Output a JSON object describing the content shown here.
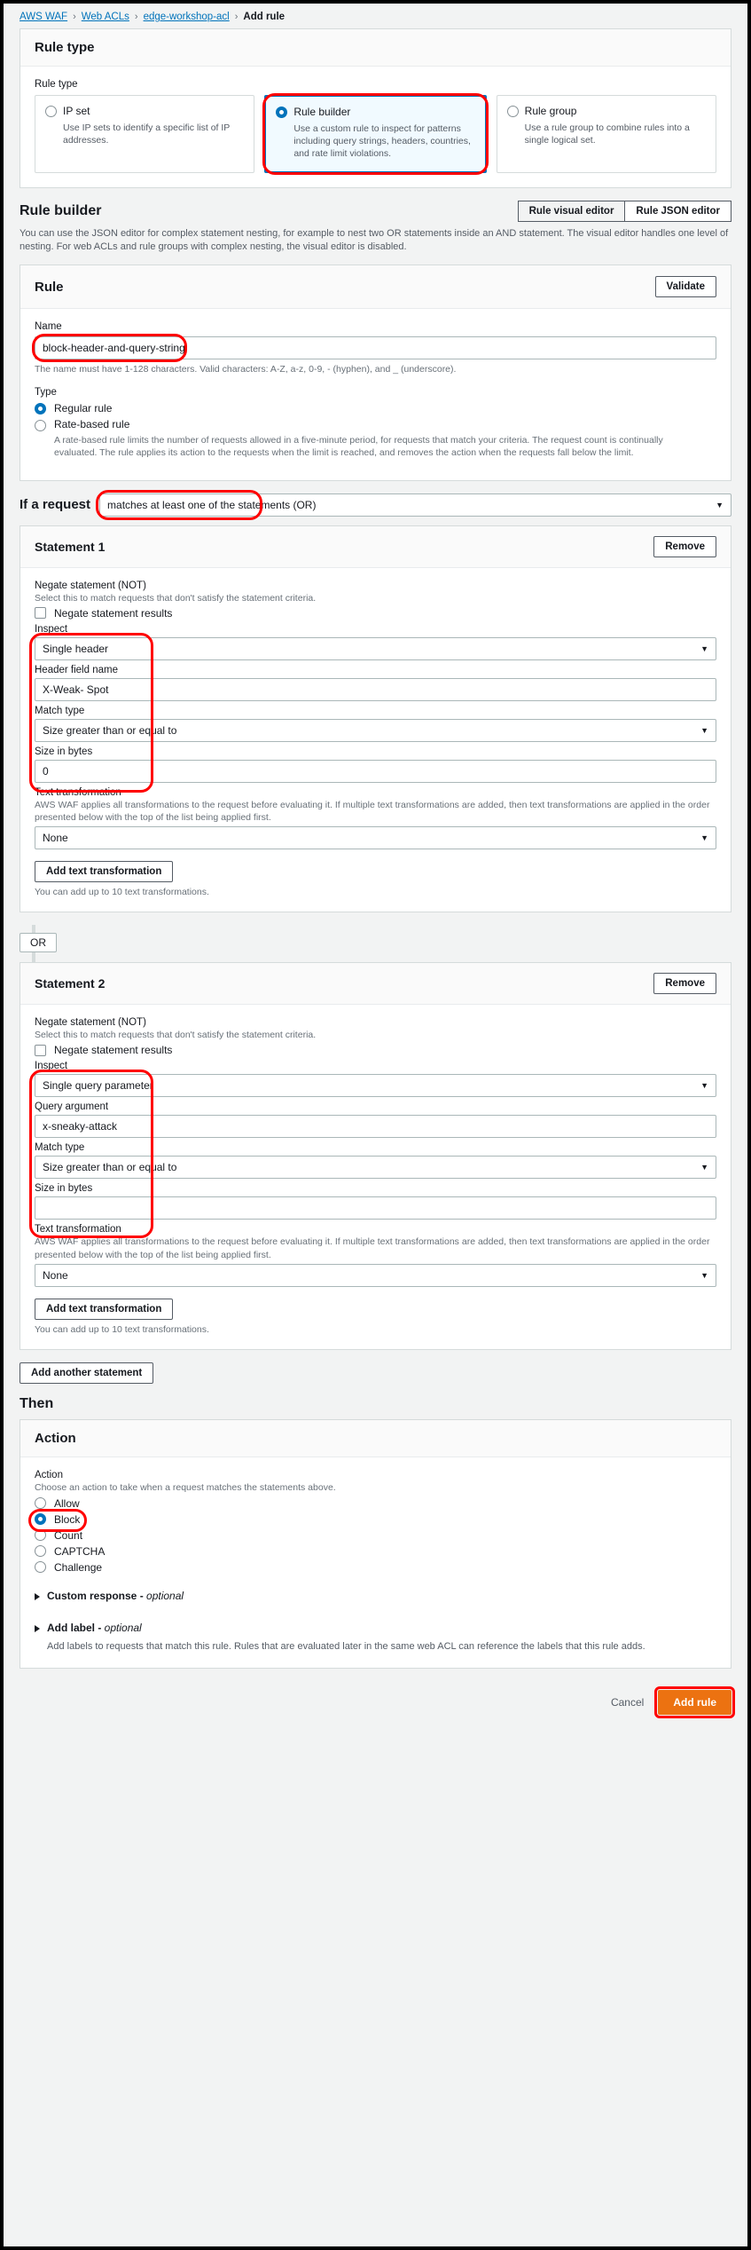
{
  "breadcrumb": {
    "items": [
      {
        "label": "AWS WAF",
        "link": true
      },
      {
        "label": "Web ACLs",
        "link": true
      },
      {
        "label": "edge-workshop-acl",
        "link": true
      },
      {
        "label": "Add rule",
        "link": false
      }
    ],
    "separator": "›"
  },
  "rule_type_section": {
    "title": "Rule type",
    "field_label": "Rule type",
    "cards": [
      {
        "title": "IP set",
        "description": "Use IP sets to identify a specific list of IP addresses.",
        "selected": false
      },
      {
        "title": "Rule builder",
        "description": "Use a custom rule to inspect for patterns including query strings, headers, countries, and rate limit violations.",
        "selected": true
      },
      {
        "title": "Rule group",
        "description": "Use a rule group to combine rules into a single logical set.",
        "selected": false
      }
    ]
  },
  "rule_builder": {
    "title": "Rule builder",
    "toggle": {
      "visual_editor": "Rule visual editor",
      "json_editor": "Rule JSON editor",
      "active": "Rule visual editor"
    },
    "description": "You can use the JSON editor for complex statement nesting, for example to nest two OR statements inside an AND statement. The visual editor handles one level of nesting. For web ACLs and rule groups with complex nesting, the visual editor is disabled."
  },
  "rule": {
    "title": "Rule",
    "validate_button": "Validate",
    "name_label": "Name",
    "name_value": "block-header-and-query-string",
    "name_constraint": "The name must have 1-128 characters. Valid characters: A-Z, a-z, 0-9, - (hyphen), and _ (underscore).",
    "type_label": "Type",
    "types": [
      {
        "label": "Regular rule",
        "selected": true,
        "description": ""
      },
      {
        "label": "Rate-based rule",
        "selected": false,
        "description": "A rate-based rule limits the number of requests allowed in a five-minute period, for requests that match your criteria. The request count is continually evaluated. The rule applies its action to the requests when the limit is reached, and removes the action when the requests fall below the limit."
      }
    ]
  },
  "if_a_request": {
    "label": "If a request",
    "value": "matches at least one of the statements (OR)"
  },
  "statements": [
    {
      "title": "Statement 1",
      "remove_button": "Remove",
      "negate_label": "Negate statement (NOT)",
      "negate_desc": "Select this to match requests that don't satisfy the statement criteria.",
      "negate_checkbox_label": "Negate statement results",
      "negate_checked": false,
      "inspect_label": "Inspect",
      "inspect_value": "Single header",
      "second_label": "Header field name",
      "second_value": "X-Weak- Spot",
      "match_type_label": "Match type",
      "match_type_value": "Size greater than or equal to",
      "size_label": "Size in bytes",
      "size_value": "0",
      "text_transformation_label": "Text transformation",
      "text_transformation_desc": "AWS WAF applies all transformations to the request before evaluating it. If multiple text transformations are added, then text transformations are applied in the order presented below with the top of the list being applied first.",
      "text_transformation_value": "None",
      "add_transformation_button": "Add text transformation",
      "add_transformation_note": "You can add up to 10 text transformations."
    },
    {
      "title": "Statement 2",
      "remove_button": "Remove",
      "negate_label": "Negate statement (NOT)",
      "negate_desc": "Select this to match requests that don't satisfy the statement criteria.",
      "negate_checkbox_label": "Negate statement results",
      "negate_checked": false,
      "inspect_label": "Inspect",
      "inspect_value": "Single query parameter",
      "second_label": "Query argument",
      "second_value": "x-sneaky-attack",
      "match_type_label": "Match type",
      "match_type_value": "Size greater than or equal to",
      "size_label": "Size in bytes",
      "size_value": "",
      "text_transformation_label": "Text transformation",
      "text_transformation_desc": "AWS WAF applies all transformations to the request before evaluating it. If multiple text transformations are added, then text transformations are applied in the order presented below with the top of the list being applied first.",
      "text_transformation_value": "None",
      "add_transformation_button": "Add text transformation",
      "add_transformation_note": "You can add up to 10 text transformations."
    }
  ],
  "or_connector": "OR",
  "add_another_statement": "Add another statement",
  "then_label": "Then",
  "action": {
    "title": "Action",
    "field_label": "Action",
    "description": "Choose an action to take when a request matches the statements above.",
    "options": [
      {
        "label": "Allow",
        "selected": false
      },
      {
        "label": "Block",
        "selected": true
      },
      {
        "label": "Count",
        "selected": false
      },
      {
        "label": "CAPTCHA",
        "selected": false
      },
      {
        "label": "Challenge",
        "selected": false
      }
    ],
    "custom_response": {
      "title": "Custom response - ",
      "optional": "optional"
    },
    "add_label": {
      "title": "Add label - ",
      "optional": "optional",
      "description": "Add labels to requests that match this rule. Rules that are evaluated later in the same web ACL can reference the labels that this rule adds."
    }
  },
  "footer": {
    "cancel": "Cancel",
    "add_rule": "Add rule"
  },
  "colors": {
    "accent": "#0073bb",
    "primary_button": "#ec7211",
    "highlight": "#ff0000"
  }
}
